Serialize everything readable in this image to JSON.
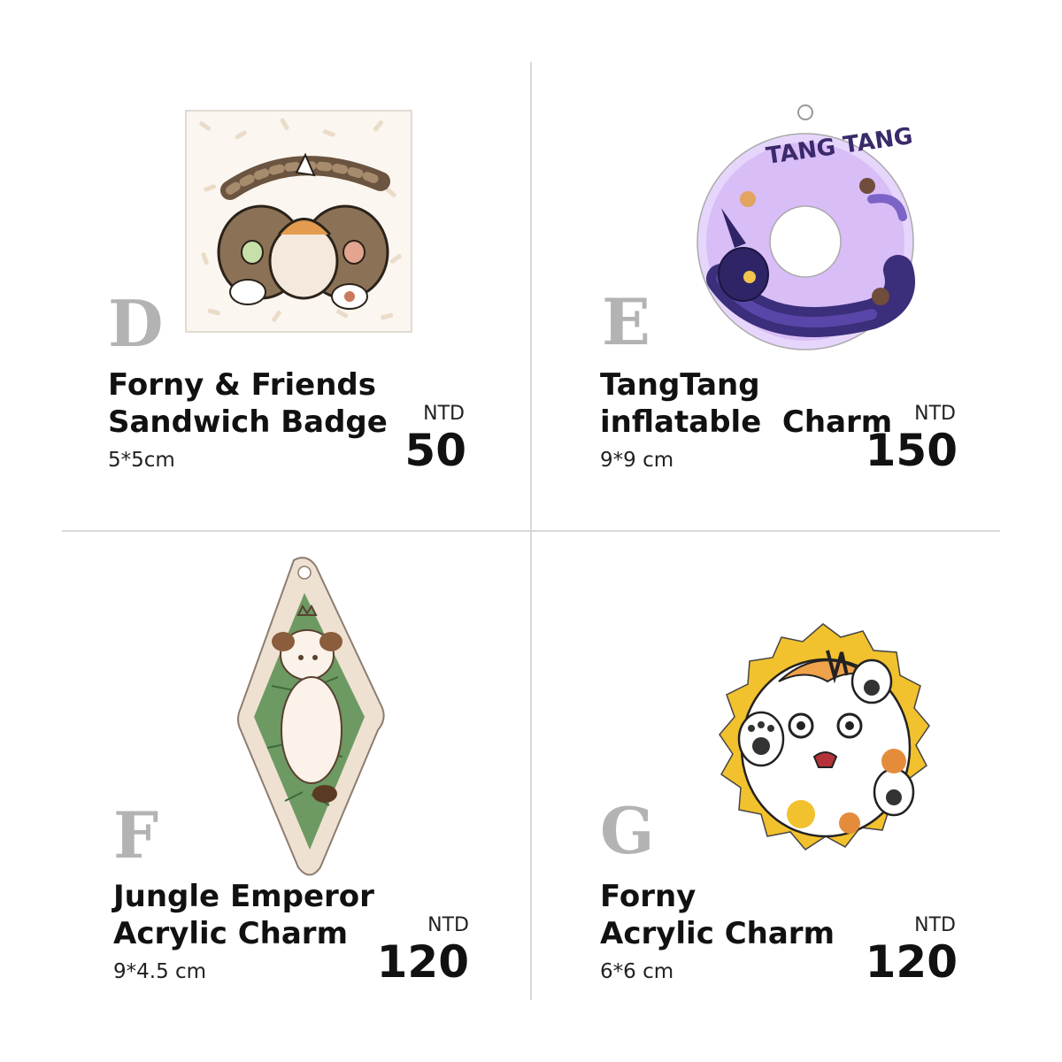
{
  "products": [
    {
      "letter": "D",
      "title_line1": "Forny & Friends",
      "title_line2": "Sandwich Badge",
      "size": "5*5cm",
      "currency": "NTD",
      "price": "50"
    },
    {
      "letter": "E",
      "title_line1": "TangTang",
      "title_line2": "inflatable  Charm",
      "size": "9*9 cm",
      "currency": "NTD",
      "price": "150",
      "charm_text": "TANG TANG"
    },
    {
      "letter": "F",
      "title_line1": "Jungle Emperor",
      "title_line2": "Acrylic Charm",
      "size": "9*4.5 cm",
      "currency": "NTD",
      "price": "120"
    },
    {
      "letter": "G",
      "title_line1": "Forny",
      "title_line2": "Acrylic Charm",
      "size": "6*6 cm",
      "currency": "NTD",
      "price": "120"
    }
  ],
  "colors": {
    "letter": "#b3b3b3",
    "divider": "#d9d9d9",
    "purple": "#c9a6f2",
    "yellow": "#f2c12e",
    "green": "#5e8a55",
    "beige": "#efe1d2"
  }
}
